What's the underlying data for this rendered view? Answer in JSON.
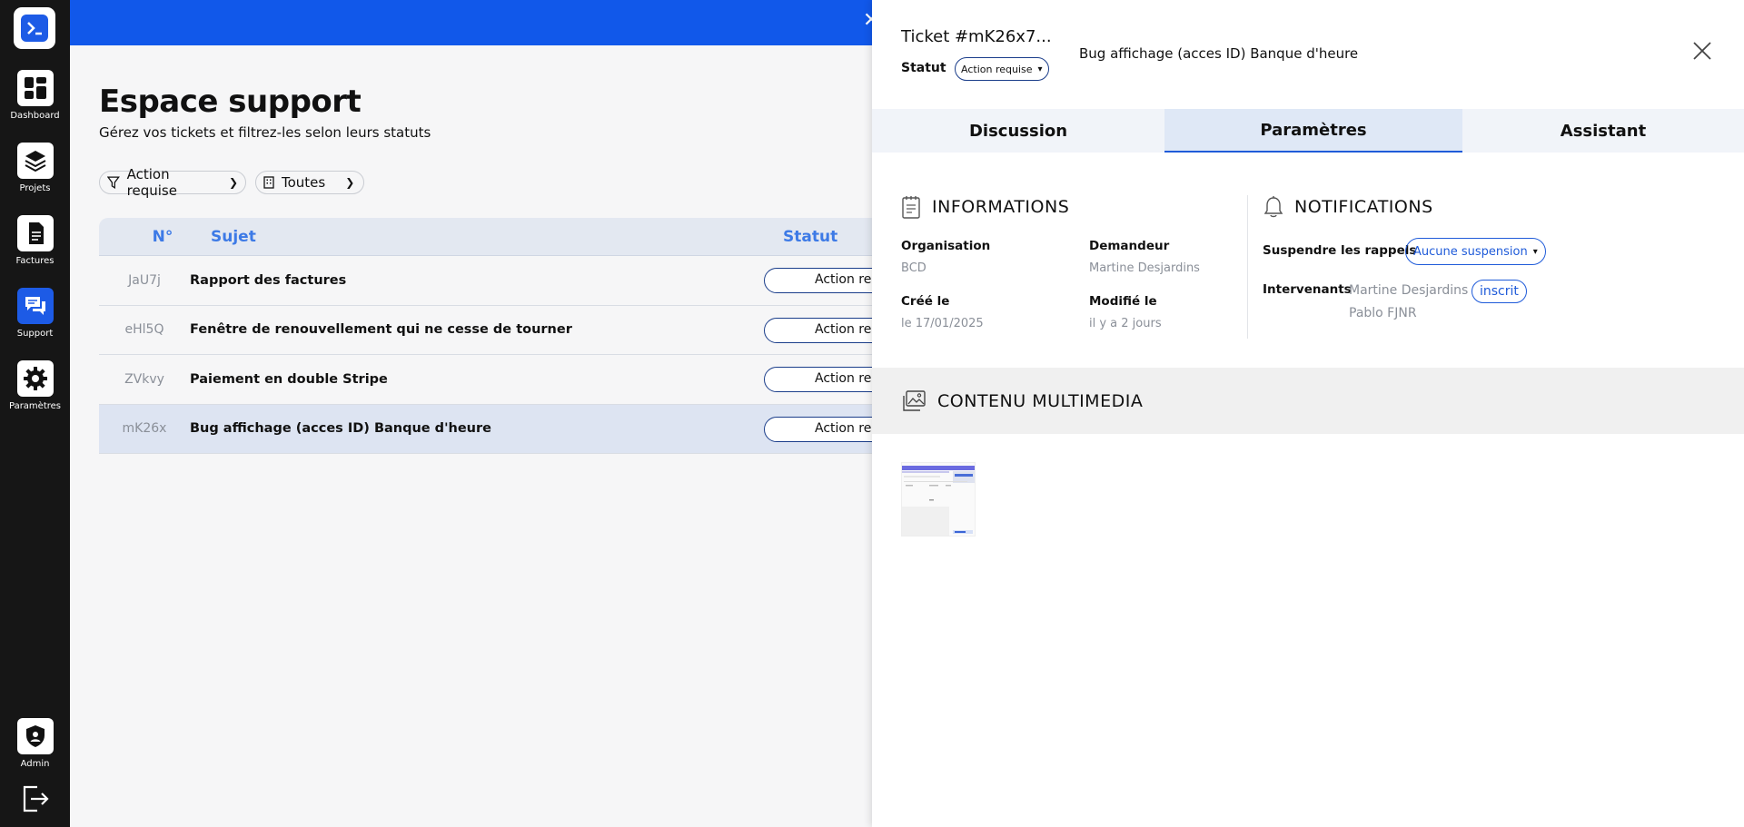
{
  "sidebar": {
    "logo_icon": "terminal-icon",
    "items": [
      {
        "label": "Dashboard",
        "icon": "dashboard-icon"
      },
      {
        "label": "Projets",
        "icon": "layers-icon"
      },
      {
        "label": "Factures",
        "icon": "document-icon"
      },
      {
        "label": "Support",
        "icon": "chat-icon"
      },
      {
        "label": "Paramètres",
        "icon": "gear-icon"
      }
    ],
    "admin": {
      "label": "Admin",
      "icon": "shield-user-icon"
    },
    "logout_icon": "logout-icon",
    "active": "Support"
  },
  "main": {
    "title": "Espace support",
    "subtitle": "Gérez vos tickets et filtrez-les selon leurs statuts",
    "filters": {
      "status": "Action requise",
      "organisation": "Toutes"
    },
    "table": {
      "headers": {
        "num": "N°",
        "subject": "Sujet",
        "status": "Statut"
      },
      "rows": [
        {
          "id": "JaU7j",
          "subject": "Rapport des factures",
          "status": "Action re"
        },
        {
          "id": "eHl5Q",
          "subject": "Fenêtre de renouvellement qui ne cesse de tourner",
          "status": "Action re"
        },
        {
          "id": "ZVkvy",
          "subject": "Paiement en double Stripe",
          "status": "Action re"
        },
        {
          "id": "mK26x",
          "subject": "Bug affichage (acces ID) Banque d'heure",
          "status": "Action re"
        }
      ]
    }
  },
  "panel": {
    "ticket_title": "Ticket #mK26x7...",
    "statut_label": "Statut",
    "statut_value": "Action requise",
    "subject": "Bug affichage (acces ID) Banque d'heure",
    "tabs": [
      "Discussion",
      "Paramètres",
      "Assistant"
    ],
    "active_tab": "Paramètres",
    "informations": {
      "heading": "INFORMATIONS",
      "organisation_label": "Organisation",
      "organisation_value": "BCD",
      "demandeur_label": "Demandeur",
      "demandeur_value": "Martine Desjardins",
      "cree_label": "Créé le",
      "cree_value": "le 17/01/2025",
      "modifie_label": "Modifié le",
      "modifie_value": "il y a 2 jours"
    },
    "notifications": {
      "heading": "NOTIFICATIONS",
      "suspend_label": "Suspendre les rappels",
      "suspend_value": "Aucune suspension",
      "intervenants_label": "Intervenants",
      "intervenants": [
        "Martine Desjardins",
        "Pablo FJNR"
      ],
      "inscrit_badge": "inscrit"
    },
    "multimedia": {
      "heading": "CONTENU MULTIMEDIA"
    }
  },
  "colors": {
    "accent": "#1158ea",
    "sidebar_bg": "#161616",
    "header_blue": "#3d7ae6"
  }
}
